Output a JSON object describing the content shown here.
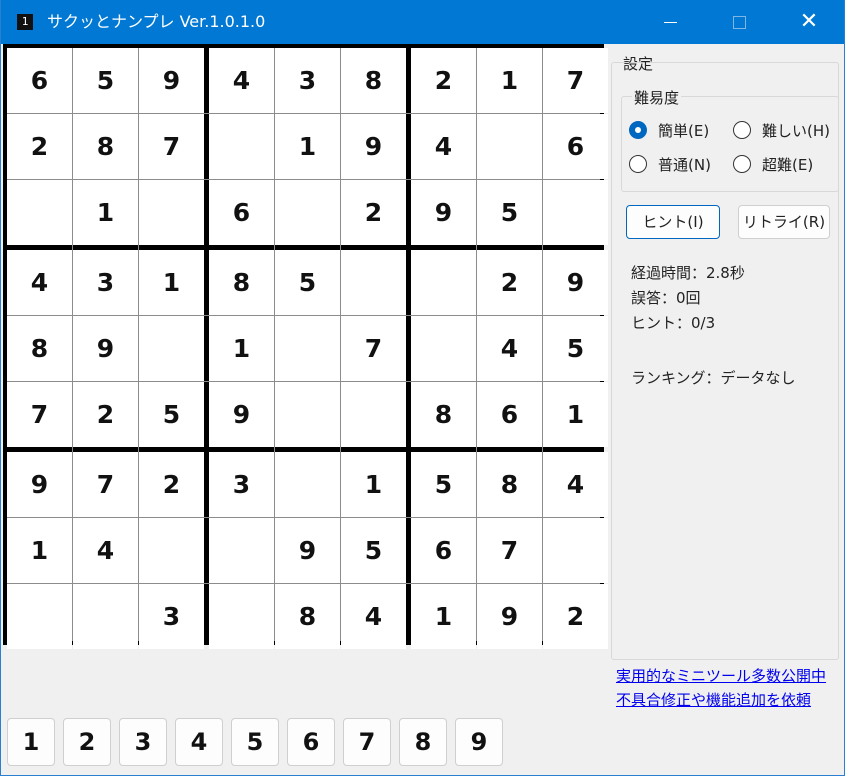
{
  "window": {
    "title": "サクッとナンプレ Ver.1.0.1.0",
    "app_icon_glyph": "1",
    "minimize_icon": "minimize-icon",
    "maximize_icon": "maximize-icon",
    "close_glyph": "✕"
  },
  "board": [
    [
      "6",
      "5",
      "9",
      "4",
      "3",
      "8",
      "2",
      "1",
      "7"
    ],
    [
      "2",
      "8",
      "7",
      "",
      "1",
      "9",
      "4",
      "",
      "6"
    ],
    [
      "",
      "1",
      "",
      "6",
      "",
      "2",
      "9",
      "5",
      ""
    ],
    [
      "4",
      "3",
      "1",
      "8",
      "5",
      "",
      "",
      "2",
      "9"
    ],
    [
      "8",
      "9",
      "",
      "1",
      "",
      "7",
      "",
      "4",
      "5"
    ],
    [
      "7",
      "2",
      "5",
      "9",
      "",
      "",
      "8",
      "6",
      "1"
    ],
    [
      "9",
      "7",
      "2",
      "3",
      "",
      "1",
      "5",
      "8",
      "4"
    ],
    [
      "1",
      "4",
      "",
      "",
      "9",
      "5",
      "6",
      "7",
      ""
    ],
    [
      "",
      "",
      "3",
      "",
      "8",
      "4",
      "1",
      "9",
      "2"
    ]
  ],
  "settings": {
    "group_label": "設定",
    "difficulty": {
      "label": "難易度",
      "options": [
        {
          "label": "簡単(E)",
          "checked": true
        },
        {
          "label": "難しい(H)",
          "checked": false
        },
        {
          "label": "普通(N)",
          "checked": false
        },
        {
          "label": "超難(E)",
          "checked": false
        }
      ]
    },
    "hint_button": "ヒント(I)",
    "retry_button": "リトライ(R)",
    "elapsed": "経過時間：2.8秒",
    "mistakes": "誤答：0回",
    "hints": "ヒント：0/3",
    "ranking": "ランキング：データなし"
  },
  "links": {
    "tools": "実用的なミニツール多数公開中",
    "request": "不具合修正や機能追加を依頼"
  },
  "number_buttons": [
    "1",
    "2",
    "3",
    "4",
    "5",
    "6",
    "7",
    "8",
    "9"
  ]
}
